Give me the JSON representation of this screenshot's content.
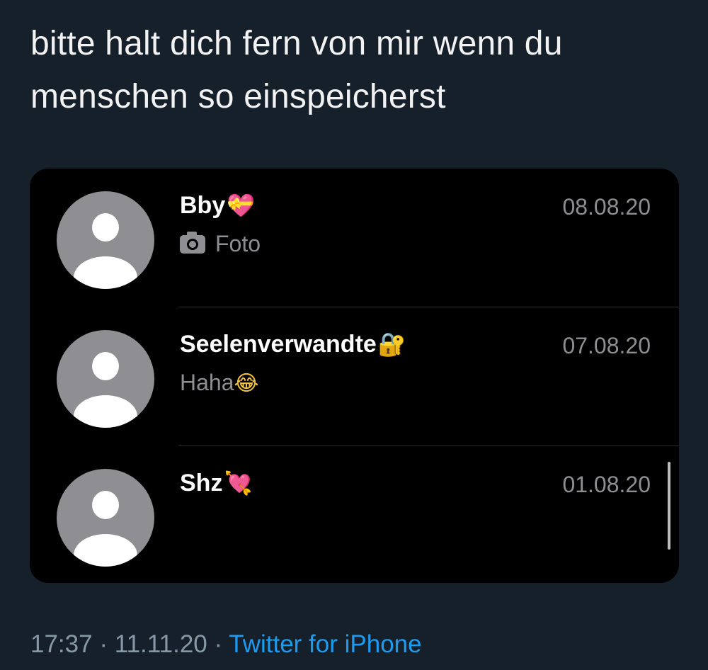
{
  "tweet": {
    "text": "bitte halt dich fern von mir wenn du\nmenschen so einspeicherst",
    "time": "17:37",
    "separator": "·",
    "date": "11.11.20",
    "source": "Twitter for iPhone"
  },
  "chats": [
    {
      "name": "Bby",
      "name_emoji": "💝",
      "date": "08.08.20",
      "preview_icon": "camera-icon",
      "preview": "Foto",
      "preview_emoji": ""
    },
    {
      "name": "Seelenverwandte",
      "name_emoji": "🔐",
      "date": "07.08.20",
      "preview_icon": "",
      "preview": "Haha",
      "preview_emoji": "😂"
    },
    {
      "name": "Shz",
      "name_emoji": "💘",
      "date": "01.08.20",
      "preview_icon": "",
      "preview": "",
      "preview_emoji": ""
    }
  ],
  "colors": {
    "background": "#15202b",
    "tweet_text": "#f2f2f2",
    "meta_text": "#8899a6",
    "link": "#1d9bf0",
    "media_background": "#000000",
    "chat_secondary": "#8e8e93",
    "avatar": "#8e8e93"
  }
}
